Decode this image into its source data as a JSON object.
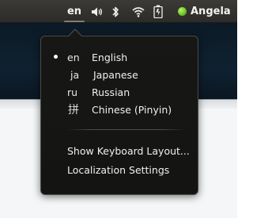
{
  "panel": {
    "keyboard_indicator": "en",
    "icons": [
      "keyboard-layout-icon",
      "volume-icon",
      "bluetooth-icon",
      "wifi-icon",
      "battery-icon"
    ],
    "user": {
      "name": "Angela",
      "presence_color": "#6cc024"
    }
  },
  "menu": {
    "languages": [
      {
        "code": "en",
        "label": "English",
        "selected": true
      },
      {
        "code": "ja",
        "label": "Japanese",
        "selected": false
      },
      {
        "code": "ru",
        "label": "Russian",
        "selected": false
      },
      {
        "code": "拼",
        "label": "Chinese (Pinyin)",
        "selected": false
      }
    ],
    "actions": [
      {
        "label": "Show Keyboard Layout..."
      },
      {
        "label": "Localization Settings"
      }
    ]
  },
  "colors": {
    "panel_bg": "#2c2b28",
    "menu_bg": "#171715",
    "text": "#f0f0ee"
  }
}
